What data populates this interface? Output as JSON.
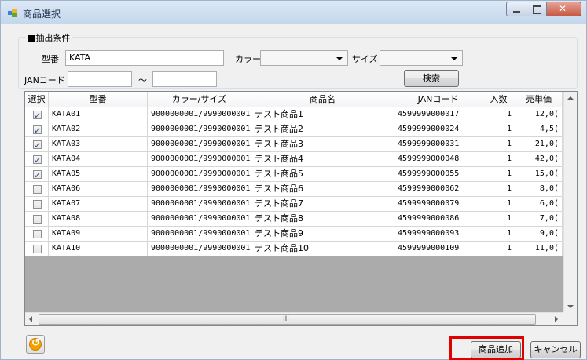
{
  "window": {
    "title": "商品選択"
  },
  "filter": {
    "group_title": "■抽出条件",
    "model_label": "型番",
    "model_value": "KATA",
    "color_label": "カラー",
    "color_value": "",
    "size_label": "サイズ",
    "size_value": "",
    "jan_label": "JANコード",
    "jan_from": "",
    "range_sep": "〜",
    "jan_to": "",
    "search_label": "検索"
  },
  "grid": {
    "columns": [
      "選択",
      "型番",
      "カラー/サイズ",
      "商品名",
      "JANコード",
      "入数",
      "売単価"
    ],
    "rows": [
      {
        "checked": true,
        "model": "KATA01",
        "color_size": "9000000001/9990000001",
        "name": "テスト商品1",
        "jan": "4599999000017",
        "qty": "1",
        "price": "12,0("
      },
      {
        "checked": true,
        "model": "KATA02",
        "color_size": "9000000001/9990000001",
        "name": "テスト商品2",
        "jan": "4599999000024",
        "qty": "1",
        "price": "4,5("
      },
      {
        "checked": true,
        "model": "KATA03",
        "color_size": "9000000001/9990000001",
        "name": "テスト商品3",
        "jan": "4599999000031",
        "qty": "1",
        "price": "21,0("
      },
      {
        "checked": true,
        "model": "KATA04",
        "color_size": "9000000001/9990000001",
        "name": "テスト商品4",
        "jan": "4599999000048",
        "qty": "1",
        "price": "42,0("
      },
      {
        "checked": true,
        "model": "KATA05",
        "color_size": "9000000001/9990000001",
        "name": "テスト商品5",
        "jan": "4599999000055",
        "qty": "1",
        "price": "15,0("
      },
      {
        "checked": false,
        "model": "KATA06",
        "color_size": "9000000001/9990000001",
        "name": "テスト商品6",
        "jan": "4599999000062",
        "qty": "1",
        "price": "8,0("
      },
      {
        "checked": false,
        "model": "KATA07",
        "color_size": "9000000001/9990000001",
        "name": "テスト商品7",
        "jan": "4599999000079",
        "qty": "1",
        "price": "6,0("
      },
      {
        "checked": false,
        "model": "KATA08",
        "color_size": "9000000001/9990000001",
        "name": "テスト商品8",
        "jan": "4599999000086",
        "qty": "1",
        "price": "7,0("
      },
      {
        "checked": false,
        "model": "KATA09",
        "color_size": "9000000001/9990000001",
        "name": "テスト商品9",
        "jan": "4599999000093",
        "qty": "1",
        "price": "9,0("
      },
      {
        "checked": false,
        "model": "KATA10",
        "color_size": "9000000001/9990000001",
        "name": "テスト商品10",
        "jan": "4599999000109",
        "qty": "1",
        "price": "11,0("
      }
    ],
    "hscroll_grip": "III"
  },
  "footer": {
    "add_label": "商品追加",
    "cancel_label": "キャンセル"
  },
  "colors": {
    "highlight": "#e00000",
    "back_icon": "#f4a100"
  }
}
